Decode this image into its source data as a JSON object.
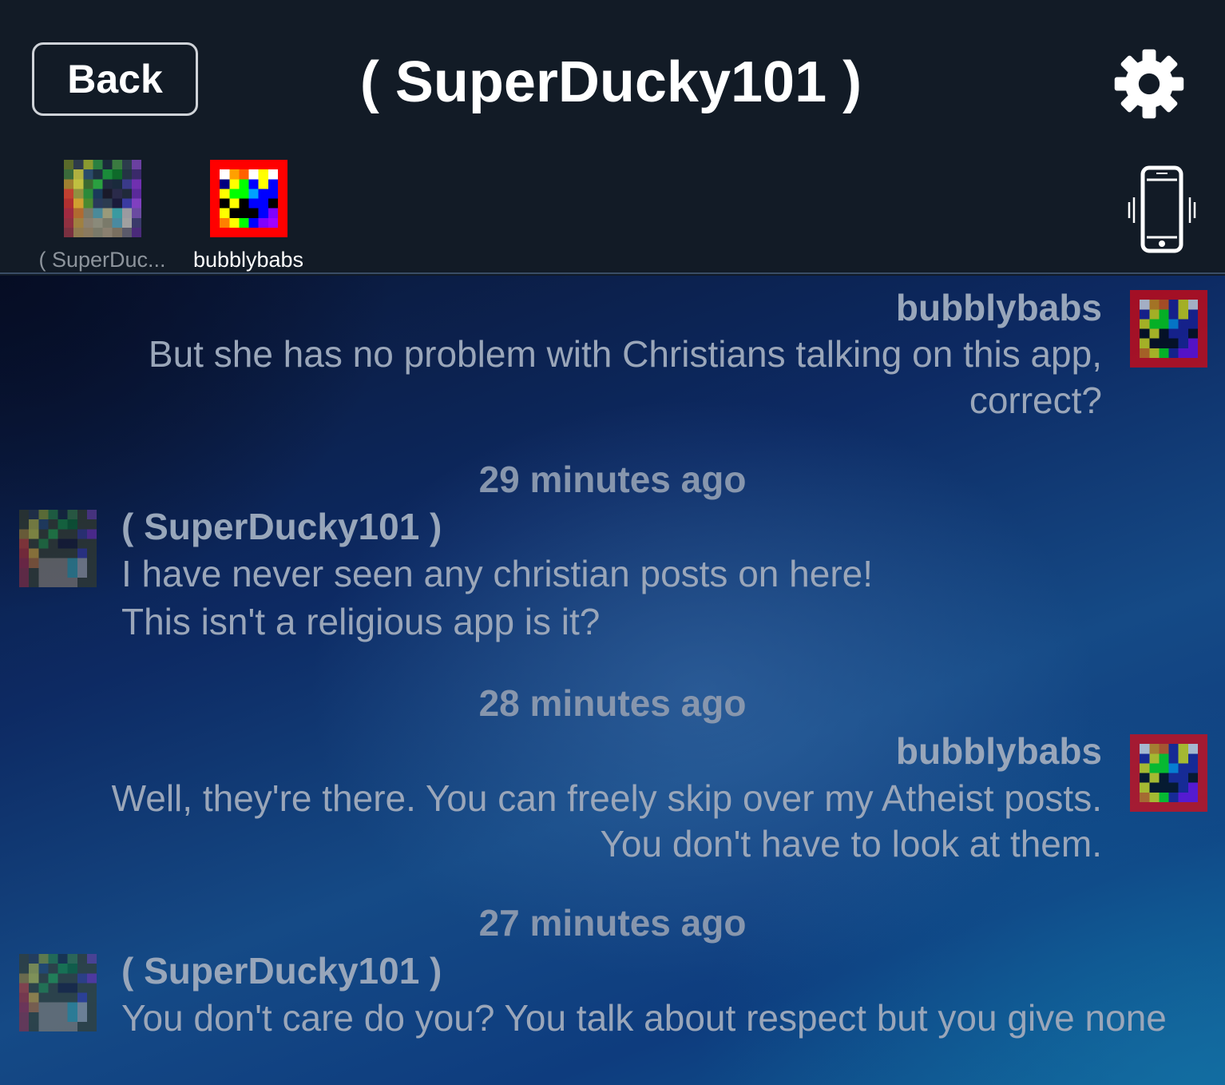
{
  "header": {
    "back_label": "Back",
    "title": "( SuperDucky101 )",
    "participants": [
      {
        "label": "( SuperDuc..."
      },
      {
        "label": "bubblybabs"
      }
    ]
  },
  "icons": {
    "settings": "gear-icon",
    "vibrate": "phone-vibrate-icon"
  },
  "messages": [
    {
      "sender": "bubblybabs",
      "lines": [
        "But she has no problem with Christians talking on this app,",
        "correct?"
      ]
    },
    {
      "timestamp": "29 minutes ago",
      "sender": "( SuperDucky101 )",
      "lines": [
        "I have never seen any christian posts on here!",
        "This isn't a religious app is it?"
      ]
    },
    {
      "timestamp": "28 minutes ago",
      "sender": "bubblybabs",
      "lines": [
        "Well, they're there.  You can freely skip over my Atheist posts.",
        "You don't have to look at them."
      ]
    },
    {
      "timestamp": "27 minutes ago",
      "sender": "( SuperDucky101 )",
      "lines": [
        "You don't care do you? You talk about respect but you give none"
      ]
    }
  ],
  "colors": {
    "header_bg": "#121b26",
    "chat_bg_dark": "#0a1634",
    "chat_bg_light": "#154a86",
    "message_text": "#9aa6b9"
  }
}
